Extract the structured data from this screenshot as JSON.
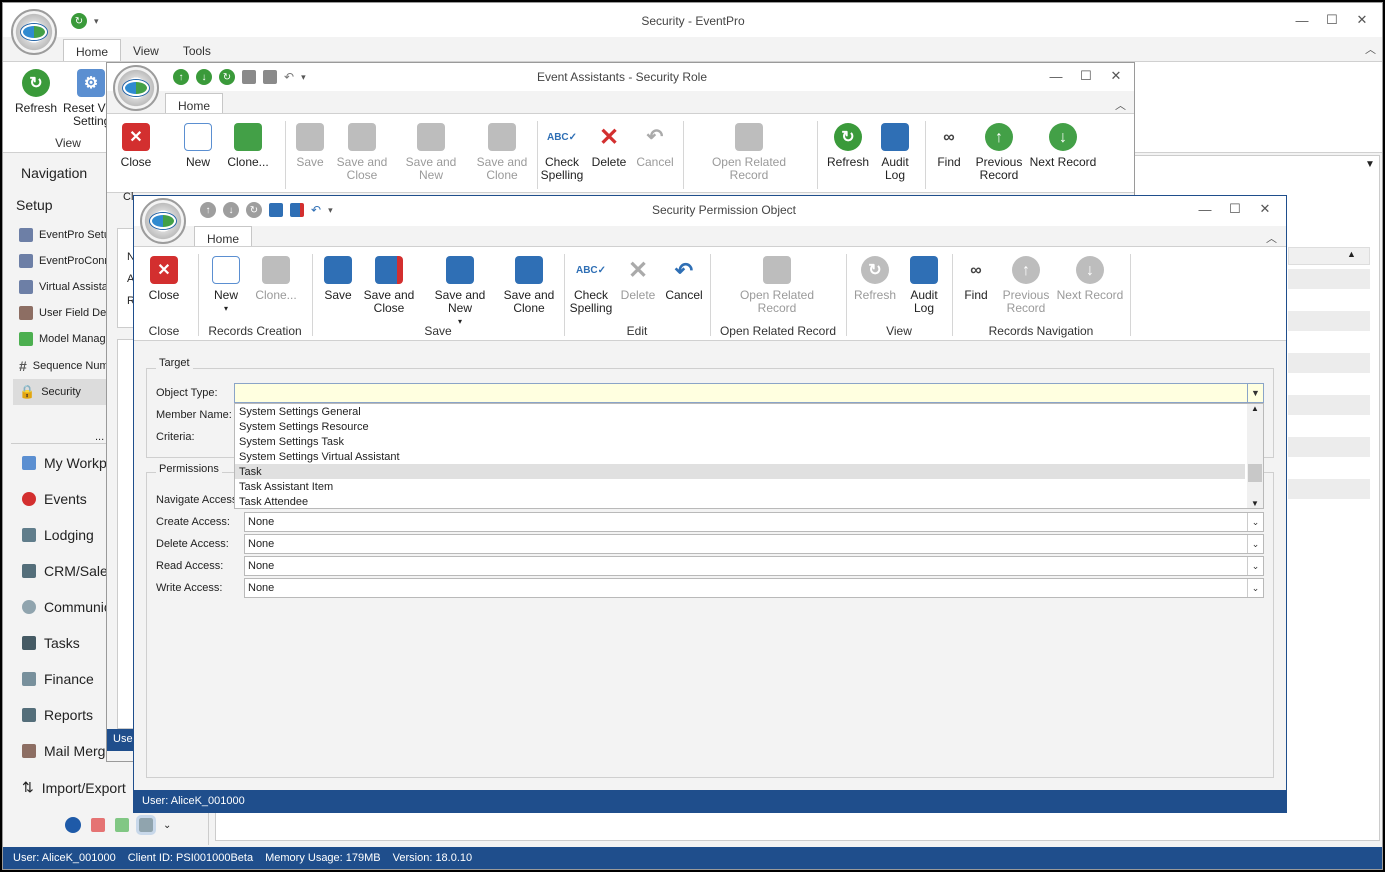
{
  "main": {
    "title": "Security - EventPro",
    "tabs": [
      "Home",
      "View",
      "Tools"
    ],
    "ribbon": {
      "refresh": "Refresh",
      "reset_view": "Reset Vi",
      "reset_view2": "Setting",
      "group_view": "View"
    },
    "nav": {
      "title": "Navigation",
      "setup": "Setup",
      "items": [
        "EventPro Setu",
        "EventProConn",
        "Virtual Assista",
        "User Field Def",
        "Model Manage",
        "Sequence Num",
        "Security"
      ],
      "modules": [
        "My Workp",
        "Events",
        "Lodging",
        "CRM/Sales",
        "Communic",
        "Tasks",
        "Finance",
        "Reports",
        "Mail Merge",
        "Import/Export"
      ],
      "more": "..."
    },
    "status": {
      "user": "User: AliceK_001000",
      "client": "Client ID: PSI001000Beta",
      "memory": "Memory Usage: 179MB",
      "version": "Version: 18.0.10"
    }
  },
  "role_window": {
    "title": "Event Assistants - Security Role",
    "tab": "Home",
    "buttons": {
      "close": "Close",
      "new": "New",
      "clone": "Clone...",
      "save": "Save",
      "save_close": "Save and",
      "save_close2": "Close",
      "save_new": "Save and New",
      "save_clone": "Save and",
      "save_clone2": "Clone",
      "check": "Check",
      "check2": "Spelling",
      "delete": "Delete",
      "cancel": "Cancel",
      "open_related": "Open Related",
      "open_related2": "Record",
      "refresh": "Refresh",
      "audit": "Audit",
      "audit2": "Log",
      "find": "Find",
      "previous": "Previous",
      "previous2": "Record",
      "next": "Next Record"
    },
    "frag": {
      "c": "Cl",
      "n": "N",
      "a": "A",
      "r": "R",
      "user": "Use"
    }
  },
  "perm_window": {
    "title": "Security Permission Object",
    "tab": "Home",
    "buttons": {
      "close": "Close",
      "new": "New",
      "clone": "Clone...",
      "save": "Save",
      "save_close": "Save and",
      "save_close2": "Close",
      "save_new": "Save and New",
      "save_clone": "Save and",
      "save_clone2": "Clone",
      "check": "Check",
      "check2": "Spelling",
      "delete": "Delete",
      "cancel": "Cancel",
      "open_related": "Open Related",
      "open_related2": "Record",
      "refresh": "Refresh",
      "audit": "Audit",
      "audit2": "Log",
      "find": "Find",
      "previous": "Previous",
      "previous2": "Record",
      "next": "Next Record"
    },
    "groups": {
      "close": "Close",
      "records_creation": "Records Creation",
      "save": "Save",
      "edit": "Edit",
      "open_related": "Open Related Record",
      "view": "View",
      "records_nav": "Records Navigation"
    },
    "target": {
      "legend": "Target",
      "object_type_label": "Object Type:",
      "object_type_value": "",
      "member_name_label": "Member Name:",
      "criteria_label": "Criteria:",
      "options": [
        "System Settings General",
        "System Settings Resource",
        "System Settings Task",
        "System Settings Virtual Assistant",
        "Task",
        "Task Assistant Item",
        "Task Attendee"
      ],
      "highlighted": "Task"
    },
    "permissions": {
      "legend": "Permissions",
      "navigate_label": "Navigate Access",
      "create_label": "Create Access:",
      "create_value": "None",
      "delete_label": "Delete Access:",
      "delete_value": "None",
      "read_label": "Read Access:",
      "read_value": "None",
      "write_label": "Write Access:",
      "write_value": "None"
    },
    "status_user": "User: AliceK_001000"
  },
  "colors": {
    "accent": "#1f4e8c",
    "highlight": "#ffffe0",
    "selected": "#e0e0e0"
  }
}
